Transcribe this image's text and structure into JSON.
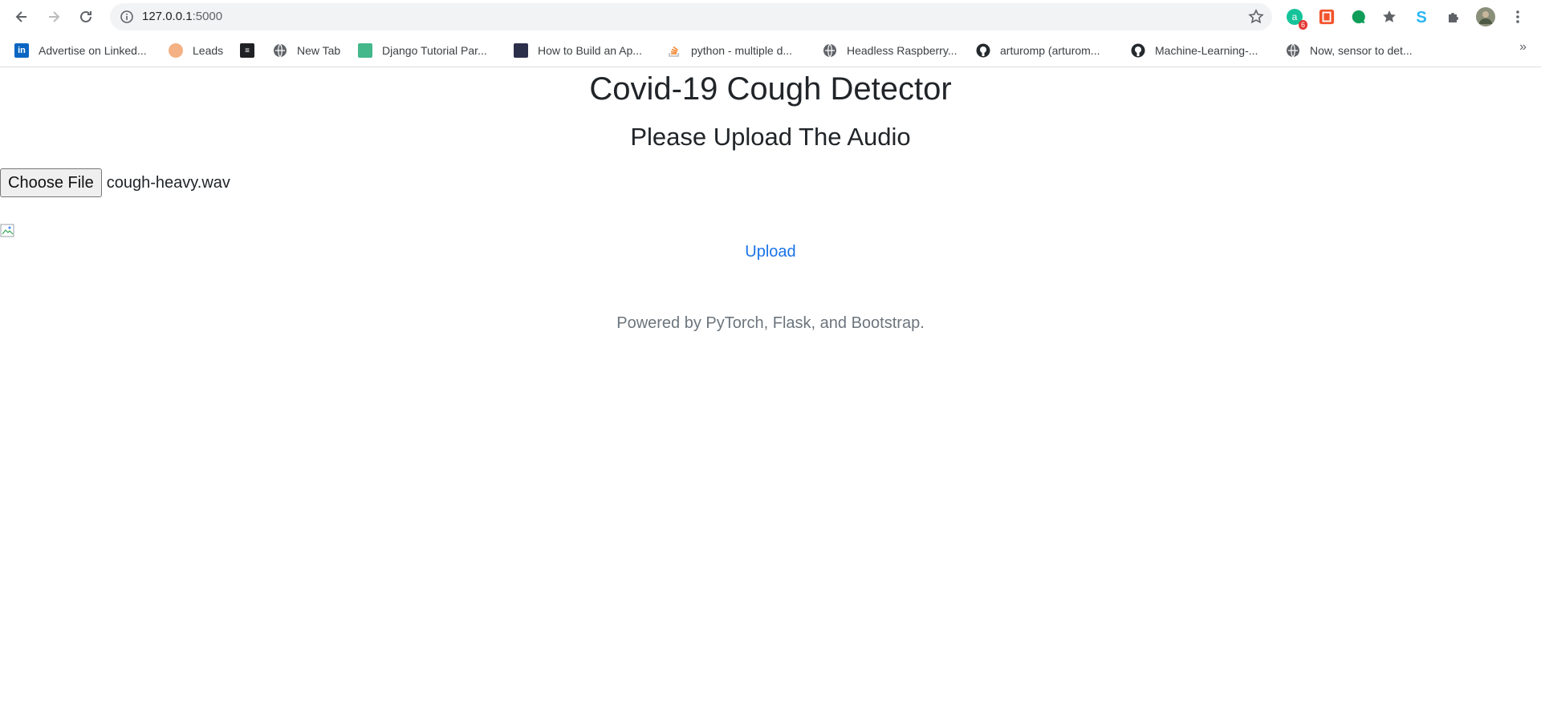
{
  "browser": {
    "url_host": "127.0.0.1",
    "url_port": ":5000",
    "extension_badge": "6",
    "bookmarks": [
      {
        "label": "Advertise on Linked...",
        "icon": "linkedin-icon"
      },
      {
        "label": "Leads",
        "icon": "leads-icon"
      },
      {
        "label": "",
        "icon": "app-icon"
      },
      {
        "label": "New Tab",
        "icon": "globe-icon"
      },
      {
        "label": "Django Tutorial Par...",
        "icon": "django-icon"
      },
      {
        "label": "How to Build an Ap...",
        "icon": "book-icon"
      },
      {
        "label": "python - multiple d...",
        "icon": "stackoverflow-icon"
      },
      {
        "label": "Headless Raspberry...",
        "icon": "globe-icon"
      },
      {
        "label": "arturomp (arturom...",
        "icon": "github-icon"
      },
      {
        "label": "Machine-Learning-...",
        "icon": "github-icon"
      },
      {
        "label": "Now, sensor to det...",
        "icon": "globe-icon"
      }
    ],
    "more_label": "»",
    "colors": {
      "linkedin": "#0a66c2",
      "link": "#1a73e8"
    }
  },
  "page": {
    "title": "Covid-19 Cough Detector",
    "subtitle": "Please Upload The Audio",
    "choose_file_label": "Choose File",
    "file_name": "cough-heavy.wav",
    "upload_label": "Upload",
    "footer": "Powered by PyTorch, Flask, and Bootstrap."
  }
}
